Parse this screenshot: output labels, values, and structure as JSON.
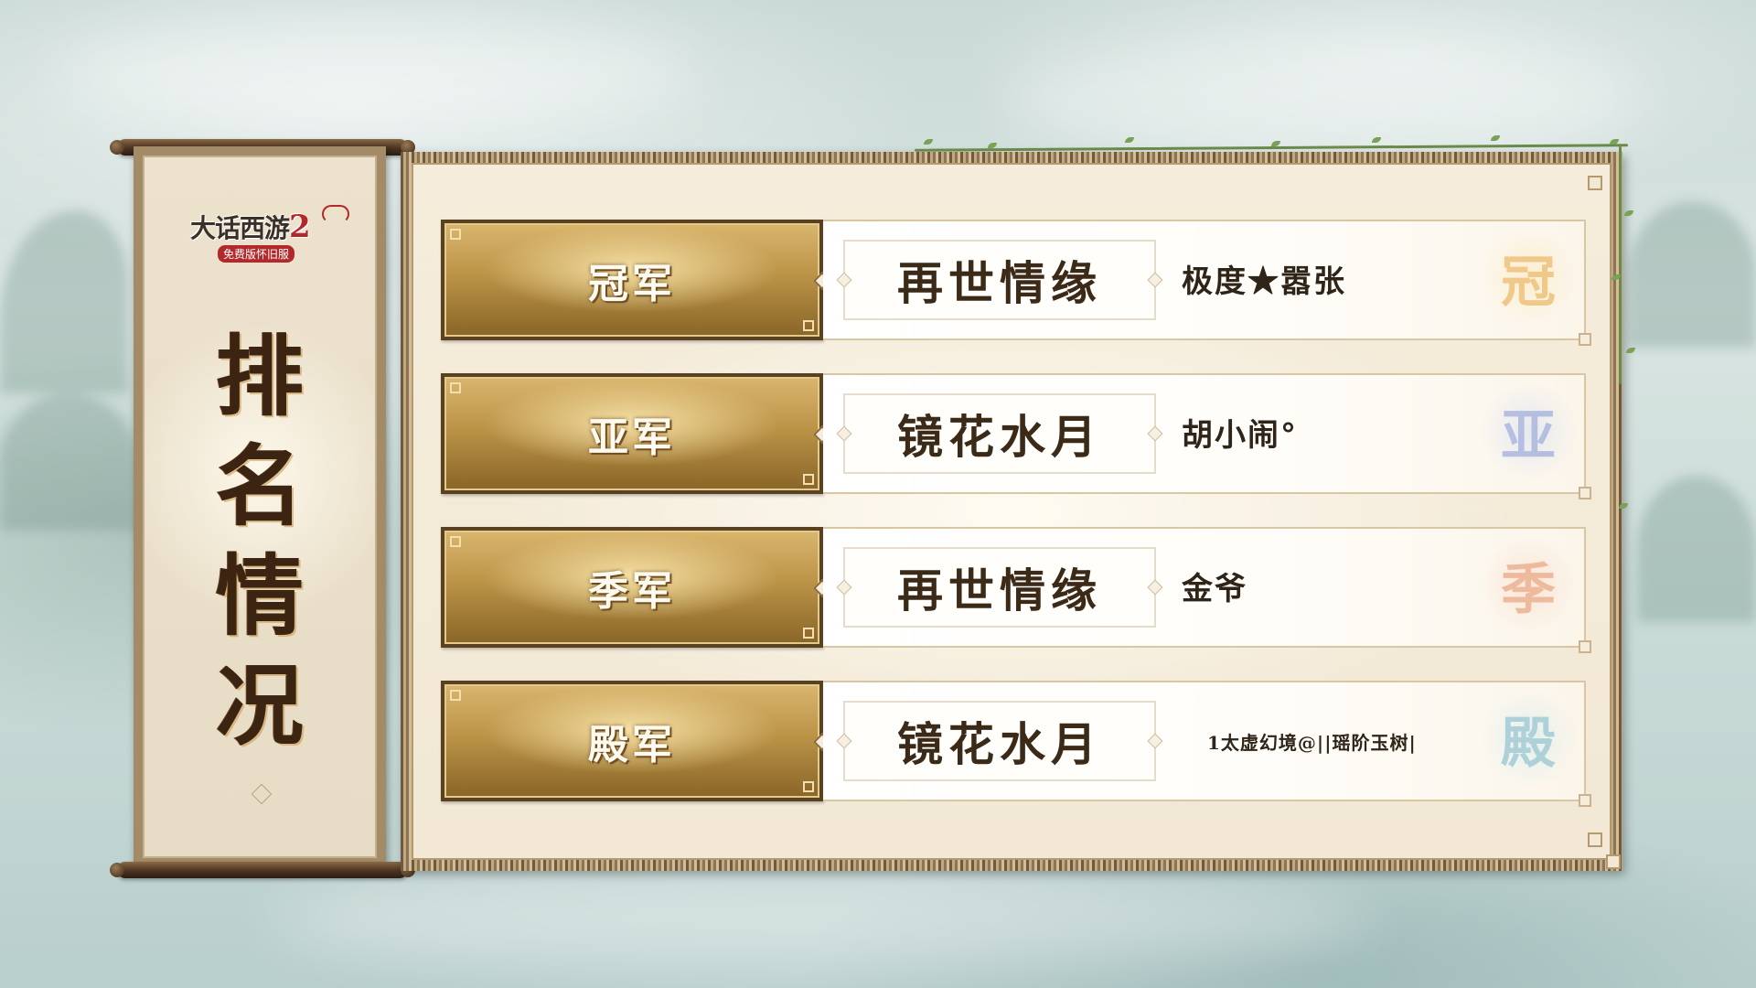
{
  "logo": {
    "title": "大话西游",
    "number": "2",
    "subtitle": "免费版怀旧服"
  },
  "scroll": {
    "title_chars": [
      "排",
      "名",
      "情",
      "况"
    ]
  },
  "rankings": [
    {
      "rank": "冠军",
      "team": "再世情缘",
      "player": "极度★嚣张",
      "seal": "冠",
      "seal_color": "#e7a43a"
    },
    {
      "rank": "亚军",
      "team": "镜花水月",
      "player": "胡小闹°",
      "seal": "亚",
      "seal_color": "#7b93d8"
    },
    {
      "rank": "季军",
      "team": "再世情缘",
      "player": "金爷",
      "seal": "季",
      "seal_color": "#e48a5e"
    },
    {
      "rank": "殿军",
      "team": "镜花水月",
      "player": "1太虚幻境@||瑶阶玉树|",
      "seal": "殿",
      "seal_color": "#6fb3c9"
    }
  ],
  "colors": {
    "gold_plate": "#bc9448",
    "panel_bg": "#f2e8d5",
    "ink": "#3c2a18"
  }
}
